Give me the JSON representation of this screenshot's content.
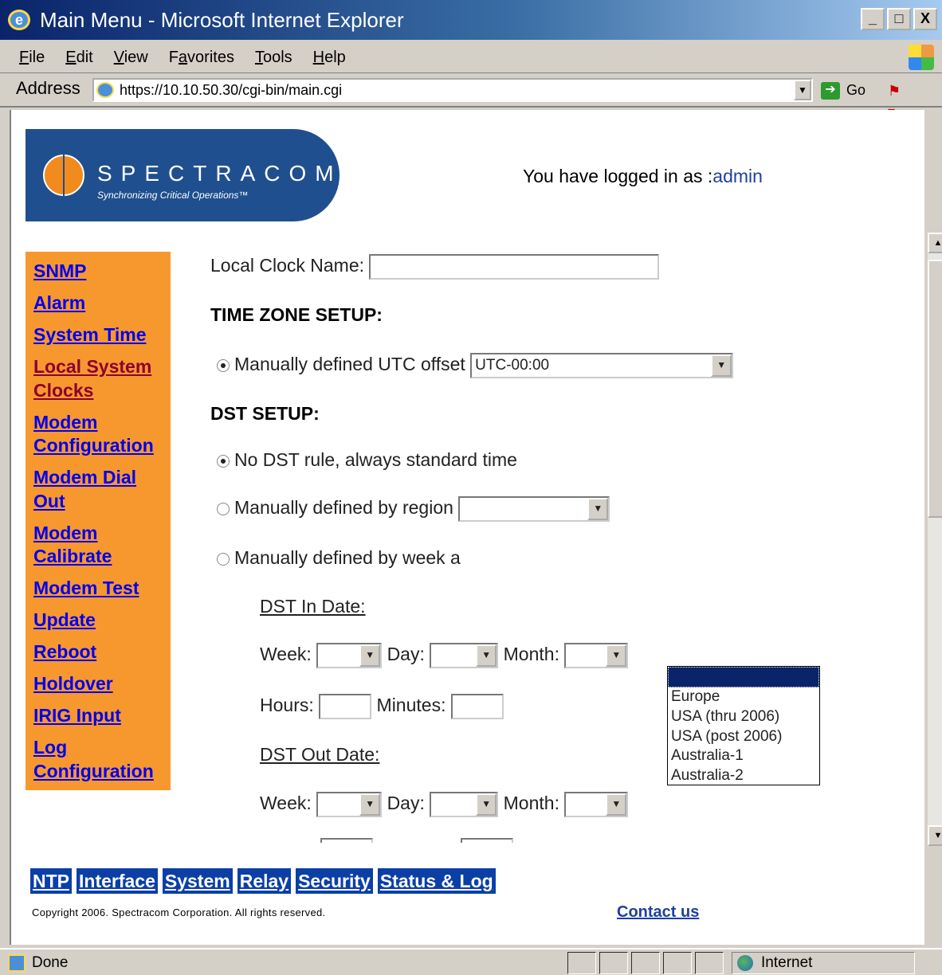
{
  "window": {
    "title": "Main Menu - Microsoft Internet Explorer",
    "buttons": [
      "_",
      "□",
      "X"
    ]
  },
  "menubar": {
    "items": [
      {
        "label": "File",
        "mnemonic": "F"
      },
      {
        "label": "Edit",
        "mnemonic": "E"
      },
      {
        "label": "View",
        "mnemonic": "V"
      },
      {
        "label": "Favorites",
        "mnemonic": "a"
      },
      {
        "label": "Tools",
        "mnemonic": "T"
      },
      {
        "label": "Help",
        "mnemonic": "H"
      }
    ]
  },
  "address": {
    "label": "Address",
    "url": "https://10.10.50.30/cgi-bin/main.cgi",
    "go_label": "Go"
  },
  "header": {
    "logo_text": "SPECTRACOM",
    "logo_tagline": "Synchronizing Critical Operations™",
    "logged_prefix": "You have logged in as :",
    "username": "admin"
  },
  "sidebar": {
    "items": [
      {
        "label": "SNMP",
        "visited": false
      },
      {
        "label": "Alarm",
        "visited": false
      },
      {
        "label": "System Time",
        "visited": false
      },
      {
        "label": "Local System Clocks",
        "visited": true
      },
      {
        "label": "Modem Configuration",
        "visited": false
      },
      {
        "label": "Modem Dial Out",
        "visited": false
      },
      {
        "label": "Modem Calibrate",
        "visited": false
      },
      {
        "label": "Modem Test",
        "visited": false
      },
      {
        "label": "Update",
        "visited": false
      },
      {
        "label": "Reboot",
        "visited": false
      },
      {
        "label": "Holdover",
        "visited": false
      },
      {
        "label": "IRIG Input",
        "visited": false
      },
      {
        "label": "Log Configuration",
        "visited": false
      }
    ]
  },
  "form": {
    "clock_name_label": "Local Clock Name:",
    "clock_name_value": "",
    "tz_heading": "TIME ZONE SETUP:",
    "utc_option_label": "Manually defined UTC offset",
    "utc_value": "UTC-00:00",
    "dst_heading": "DST SETUP:",
    "dst_none_label": "No DST rule, always standard time",
    "dst_region_label": "Manually defined by region",
    "dst_region_value": "",
    "dst_week_label": "Manually defined by week a",
    "dst_in_label": "DST In Date:",
    "dst_out_label": "DST Out Date:",
    "week_label": "Week:",
    "day_label": "Day:",
    "month_label": "Month:",
    "hours_label": "Hours:",
    "minutes_label": "Minutes:",
    "region_options": [
      "",
      "Europe",
      "USA (thru 2006)",
      "USA (post 2006)",
      "Australia-1",
      "Australia-2"
    ]
  },
  "bottom_nav": {
    "items": [
      "NTP",
      "Interface",
      "System",
      "Relay",
      "Security",
      "Status & Log"
    ]
  },
  "footer": {
    "copyright": "Copyright 2006. Spectracom Corporation. All rights reserved.",
    "contact": "Contact us"
  },
  "status": {
    "text": "Done",
    "zone": "Internet"
  },
  "colors": {
    "sidebar_bg": "#f7982f",
    "link": "#0000ee",
    "visited_link": "#8b0032",
    "nav_bg": "#0b3fa6",
    "logo_bg": "#1f4f8f"
  }
}
